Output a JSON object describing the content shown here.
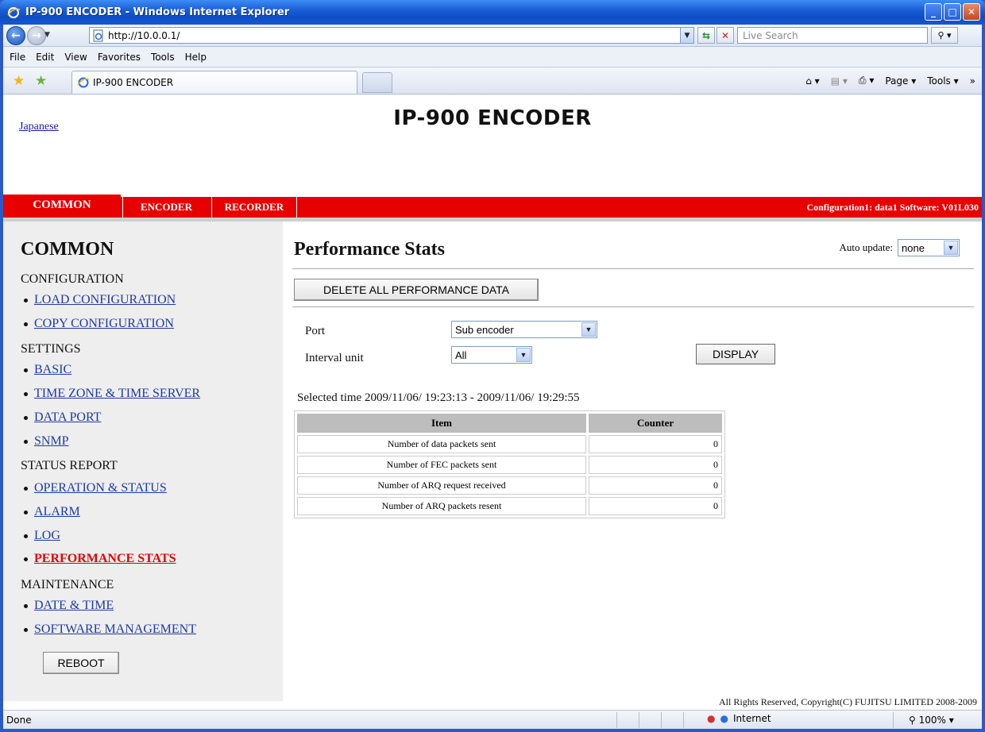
{
  "window": {
    "title": "IP-900 ENCODER - Windows Internet Explorer",
    "min": "_",
    "max": "□",
    "close": "✕"
  },
  "browser": {
    "address": "http://10.0.0.1/",
    "search_placeholder": "Live Search",
    "menu": [
      "File",
      "Edit",
      "View",
      "Favorites",
      "Tools",
      "Help"
    ],
    "tab_title": "IP-900 ENCODER",
    "commands": [
      "Page ▾",
      "Tools ▾"
    ],
    "status": "Done",
    "zone": "Internet",
    "zoom": "100%"
  },
  "page": {
    "language_link": "Japanese",
    "title": "IP-900 ENCODER",
    "tabs": [
      "COMMON",
      "ENCODER",
      "RECORDER"
    ],
    "config_info": "Configuration1: data1 Software: V01L030",
    "copyright": "All Rights Reserved, Copyright(C) FUJITSU LIMITED 2008-2009"
  },
  "sidebar": {
    "heading": "COMMON",
    "sections": [
      {
        "title": "CONFIGURATION",
        "items": [
          "LOAD CONFIGURATION",
          "COPY CONFIGURATION"
        ]
      },
      {
        "title": "SETTINGS",
        "items": [
          "BASIC",
          "TIME ZONE & TIME SERVER",
          "DATA PORT",
          "SNMP"
        ]
      },
      {
        "title": "STATUS REPORT",
        "items": [
          "OPERATION & STATUS",
          "ALARM",
          "LOG",
          "PERFORMANCE STATS"
        ]
      },
      {
        "title": "MAINTENANCE",
        "items": [
          "DATE & TIME",
          "SOFTWARE MANAGEMENT"
        ]
      }
    ],
    "active_item": "PERFORMANCE STATS",
    "reboot_label": "REBOOT"
  },
  "main": {
    "heading": "Performance Stats",
    "auto_update_label": "Auto update:",
    "auto_update_value": "none",
    "delete_label": "DELETE ALL PERFORMANCE DATA",
    "port_label": "Port",
    "port_value": "Sub encoder",
    "interval_label": "Interval unit",
    "interval_value": "All",
    "display_label": "DISPLAY",
    "selected_time": "Selected time 2009/11/06/ 19:23:13 - 2009/11/06/ 19:29:55",
    "table": {
      "headers": [
        "Item",
        "Counter"
      ],
      "rows": [
        [
          "Number of data packets sent",
          "0"
        ],
        [
          "Number of FEC packets sent",
          "0"
        ],
        [
          "Number of ARQ request received",
          "0"
        ],
        [
          "Number of ARQ packets resent",
          "0"
        ]
      ]
    }
  }
}
